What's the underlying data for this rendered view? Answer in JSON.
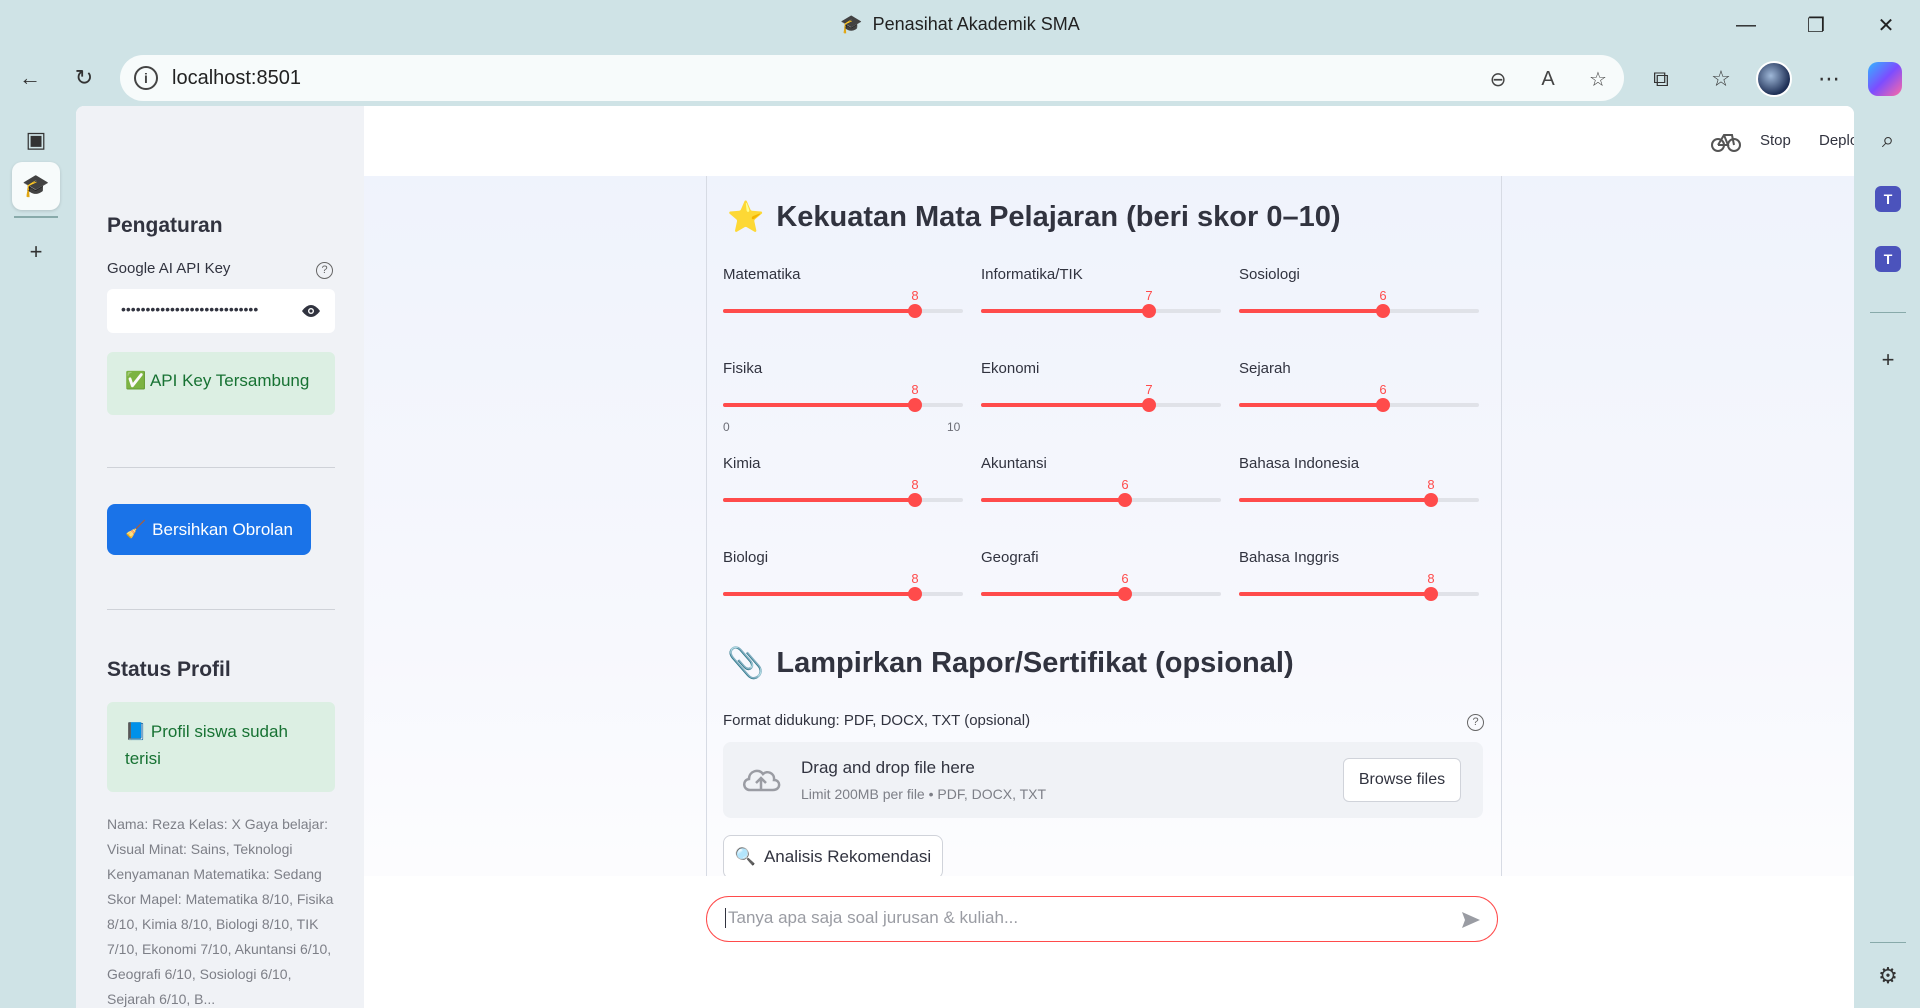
{
  "browser": {
    "window_title": "Penasihat Akademik SMA",
    "url": "localhost:8501"
  },
  "app": {
    "toolbar": {
      "stop_label": "Stop",
      "deploy_label": "Deploy"
    },
    "sidebar": {
      "settings_title": "Pengaturan",
      "api_key_label": "Google AI API Key",
      "api_key_value": "••••••••••••••••••••••••••••",
      "api_connected": "✅ API Key Tersambung",
      "clear_button": "Bersihkan Obrolan",
      "profile_title": "Status Profil",
      "profile_status": "📘 Profil siswa sudah terisi",
      "profile_summary": "Nama: Reza Kelas: X Gaya belajar: Visual Minat: Sains, Teknologi Kenyamanan Matematika: Sedang Skor Mapel: Matematika 8/10, Fisika 8/10, Kimia 8/10, Biologi 8/10, TIK 7/10, Ekonomi 7/10, Akuntansi 6/10, Geografi 6/10, Sosiologi 6/10, Sejarah 6/10, B..."
    },
    "strengths": {
      "title": "Kekuatan Mata Pelajaran (beri skor 0–10)",
      "title_emoji": "⭐",
      "range_min": "0",
      "range_max": "10",
      "sliders": [
        {
          "label": "Matematika",
          "value": 8
        },
        {
          "label": "Informatika/TIK",
          "value": 7
        },
        {
          "label": "Sosiologi",
          "value": 6
        },
        {
          "label": "Fisika",
          "value": 8
        },
        {
          "label": "Ekonomi",
          "value": 7
        },
        {
          "label": "Sejarah",
          "value": 6
        },
        {
          "label": "Kimia",
          "value": 8
        },
        {
          "label": "Akuntansi",
          "value": 6
        },
        {
          "label": "Bahasa Indonesia",
          "value": 8
        },
        {
          "label": "Biologi",
          "value": 8
        },
        {
          "label": "Geografi",
          "value": 6
        },
        {
          "label": "Bahasa Inggris",
          "value": 8
        }
      ]
    },
    "attachments": {
      "title": "Lampirkan Rapor/Sertifikat (opsional)",
      "title_emoji": "📎",
      "uploader_label": "Format didukung: PDF, DOCX, TXT (opsional)",
      "drop_text": "Drag and drop file here",
      "limit_text": "Limit 200MB per file • PDF, DOCX, TXT",
      "browse_label": "Browse files"
    },
    "analyze_button": "Analisis Rekomendasi",
    "chat_placeholder": "Tanya apa saja soal jurusan & kuliah...",
    "colors": {
      "accent": "#ff4b4b",
      "primary_button": "#1a73e8",
      "success_bg": "#dcefe3",
      "success_text": "#177233"
    }
  }
}
